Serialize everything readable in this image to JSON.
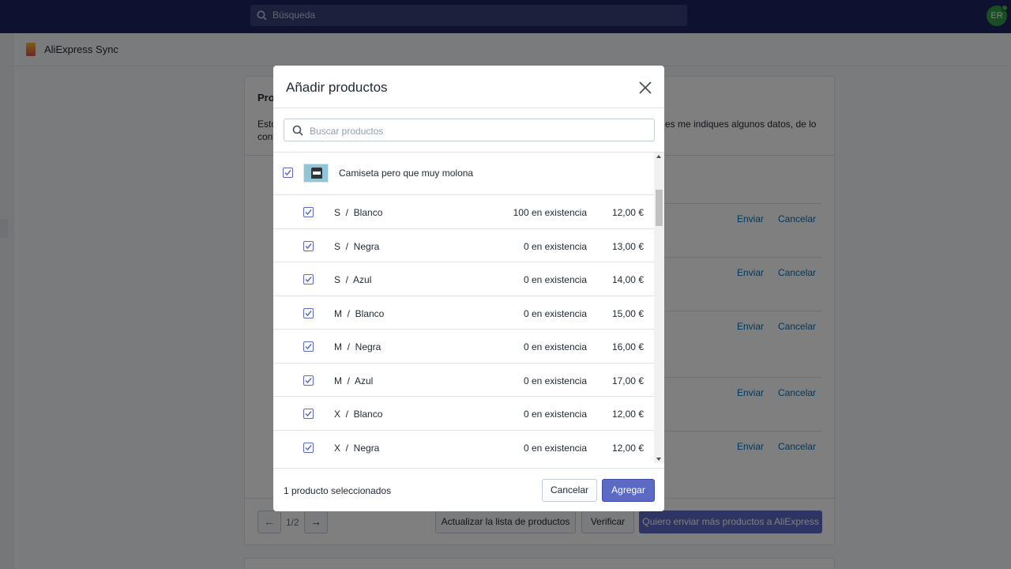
{
  "topbar": {
    "search_placeholder": "Búsqueda",
    "avatar_initials": "ER"
  },
  "app": {
    "title": "AliExpress Sync"
  },
  "card": {
    "title": "Pro",
    "desc_line1": "Esto",
    "desc_line1_right": "es me indiques algunos datos, de lo",
    "desc_line2": "cont",
    "rows": [
      {
        "send": "Enviar",
        "cancel": "Cancelar"
      },
      {
        "send": "Enviar",
        "cancel": "Cancelar"
      },
      {
        "send": "Enviar",
        "cancel": "Cancelar"
      },
      {
        "send": "Enviar",
        "cancel": "Cancelar"
      },
      {
        "send": "Enviar",
        "cancel": "Cancelar"
      }
    ],
    "pager": {
      "prev": "←",
      "text": "1/2",
      "next": "→"
    },
    "btn_update": "Actualizar la lista de productos",
    "btn_verify": "Verificar",
    "btn_send_more": "Quiero enviar más productos a AliExpress"
  },
  "modal": {
    "title": "Añadir productos",
    "search_placeholder": "Buscar productos",
    "product": {
      "name": "Camiseta pero que muy molona",
      "checked": true
    },
    "variants": [
      {
        "label": "S  /  Blanco",
        "stock": "100 en existencia",
        "price": "12,00 €"
      },
      {
        "label": "S  /  Negra",
        "stock": "0 en existencia",
        "price": "13,00 €"
      },
      {
        "label": "S  /  Azul",
        "stock": "0 en existencia",
        "price": "14,00 €"
      },
      {
        "label": "M  /  Blanco",
        "stock": "0 en existencia",
        "price": "15,00 €"
      },
      {
        "label": "M  /  Negra",
        "stock": "0 en existencia",
        "price": "16,00 €"
      },
      {
        "label": "M  /  Azul",
        "stock": "0 en existencia",
        "price": "17,00 €"
      },
      {
        "label": "X  /  Blanco",
        "stock": "0 en existencia",
        "price": "12,00 €"
      },
      {
        "label": "X  /  Negra",
        "stock": "0 en existencia",
        "price": "12,00 €"
      }
    ],
    "selected_count_text": "1 producto seleccionados",
    "cancel_label": "Cancelar",
    "add_label": "Agregar"
  },
  "colors": {
    "topbar": "#1c2260",
    "primary": "#5c6ac4",
    "link": "#006fbb"
  }
}
